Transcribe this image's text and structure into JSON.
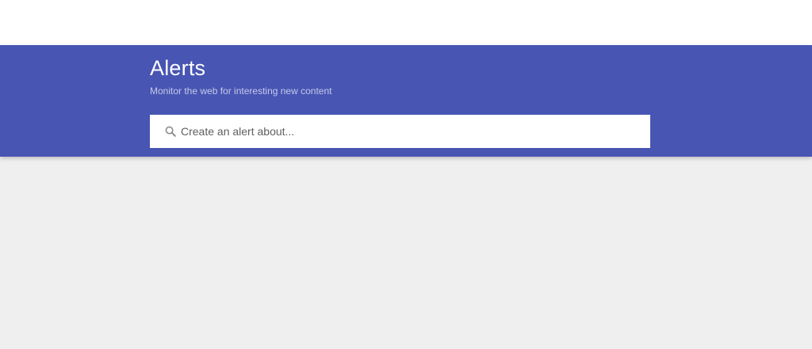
{
  "header": {
    "title": "Alerts",
    "subtitle": "Monitor the web for interesting new content"
  },
  "search": {
    "icon": "search-icon",
    "value": "",
    "placeholder": "Create an alert about..."
  },
  "colors": {
    "header_background": "#4855b3",
    "page_background": "#efefef",
    "subtitle_text": "#c5cae9"
  }
}
